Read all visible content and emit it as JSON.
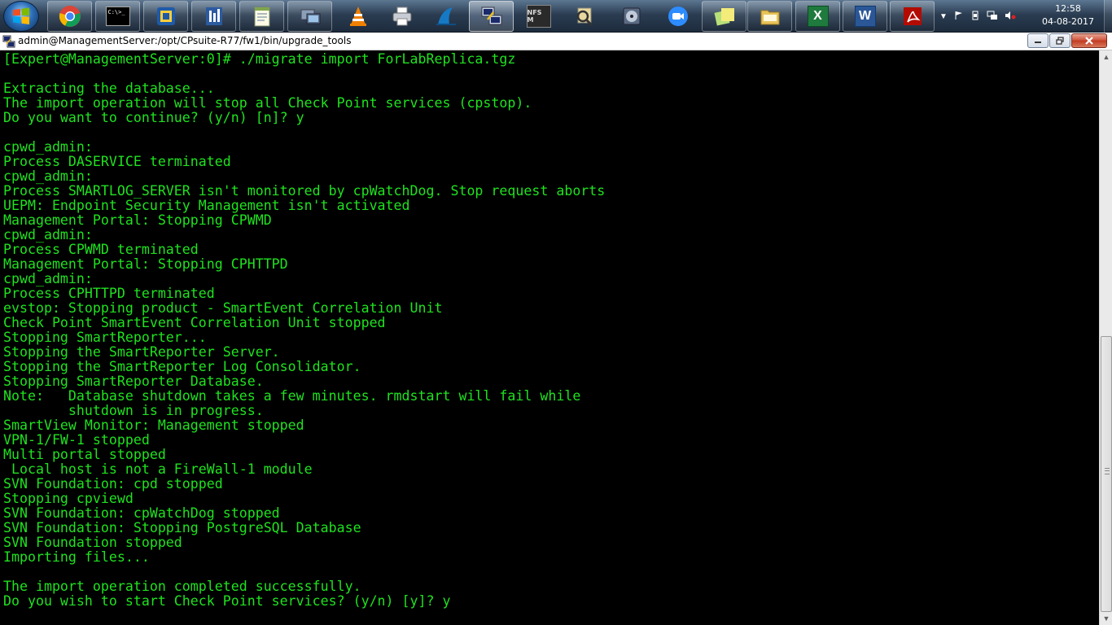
{
  "taskbar": {
    "start_icon": "windows-logo-icon",
    "apps": [
      {
        "icon": "chrome-icon",
        "label": ""
      },
      {
        "icon": "cmd-icon",
        "label": "C:\\>_"
      },
      {
        "icon": "virtualbox-icon",
        "label": ""
      },
      {
        "icon": "network-icon",
        "label": ""
      },
      {
        "icon": "notepad-icon",
        "label": ""
      },
      {
        "icon": "remote-desktop-icon",
        "label": ""
      },
      {
        "icon": "vlc-icon",
        "label": ""
      },
      {
        "icon": "printer-icon",
        "label": ""
      },
      {
        "icon": "wireshark-icon",
        "label": ""
      },
      {
        "icon": "putty-icon",
        "label": ""
      },
      {
        "icon": "nfs-game-icon",
        "label": "NFS M"
      },
      {
        "icon": "search-tool-icon",
        "label": ""
      },
      {
        "icon": "disk-icon",
        "label": ""
      },
      {
        "icon": "zoom-icon",
        "label": ""
      },
      {
        "icon": "sticky-notes-icon",
        "label": ""
      },
      {
        "icon": "folder-icon",
        "label": ""
      },
      {
        "icon": "excel-icon",
        "label": "X"
      },
      {
        "icon": "word-icon",
        "label": "W"
      },
      {
        "icon": "acrobat-icon",
        "label": ""
      }
    ],
    "tray": {
      "icons": [
        "show-hidden-icons-icon",
        "flag-icon",
        "usb-icon",
        "network-status-icon",
        "volume-muted-icon"
      ],
      "time": "12:58",
      "date": "04-08-2017"
    }
  },
  "window": {
    "title": "admin@ManagementServer:/opt/CPsuite-R77/fw1/bin/upgrade_tools",
    "icon": "putty-icon",
    "text_color": "#1fe21f",
    "background": "#000000"
  },
  "terminal": {
    "lines": [
      "[Expert@ManagementServer:0]# ./migrate import ForLabReplica.tgz",
      "",
      "Extracting the database...",
      "The import operation will stop all Check Point services (cpstop).",
      "Do you want to continue? (y/n) [n]? y",
      "",
      "cpwd_admin:",
      "Process DASERVICE terminated",
      "cpwd_admin:",
      "Process SMARTLOG_SERVER isn't monitored by cpWatchDog. Stop request aborts",
      "UEPM: Endpoint Security Management isn't activated",
      "Management Portal: Stopping CPWMD",
      "cpwd_admin:",
      "Process CPWMD terminated",
      "Management Portal: Stopping CPHTTPD",
      "cpwd_admin:",
      "Process CPHTTPD terminated",
      "evstop: Stopping product - SmartEvent Correlation Unit",
      "Check Point SmartEvent Correlation Unit stopped",
      "Stopping SmartReporter...",
      "Stopping the SmartReporter Server.",
      "Stopping the SmartReporter Log Consolidator.",
      "Stopping SmartReporter Database.",
      "Note:   Database shutdown takes a few minutes. rmdstart will fail while",
      "        shutdown is in progress.",
      "SmartView Monitor: Management stopped",
      "VPN-1/FW-1 stopped",
      "Multi portal stopped",
      " Local host is not a FireWall-1 module",
      "SVN Foundation: cpd stopped",
      "Stopping cpviewd",
      "SVN Foundation: cpWatchDog stopped",
      "SVN Foundation: Stopping PostgreSQL Database",
      "SVN Foundation stopped",
      "Importing files...",
      "",
      "The import operation completed successfully.",
      "Do you wish to start Check Point services? (y/n) [y]? y"
    ]
  }
}
